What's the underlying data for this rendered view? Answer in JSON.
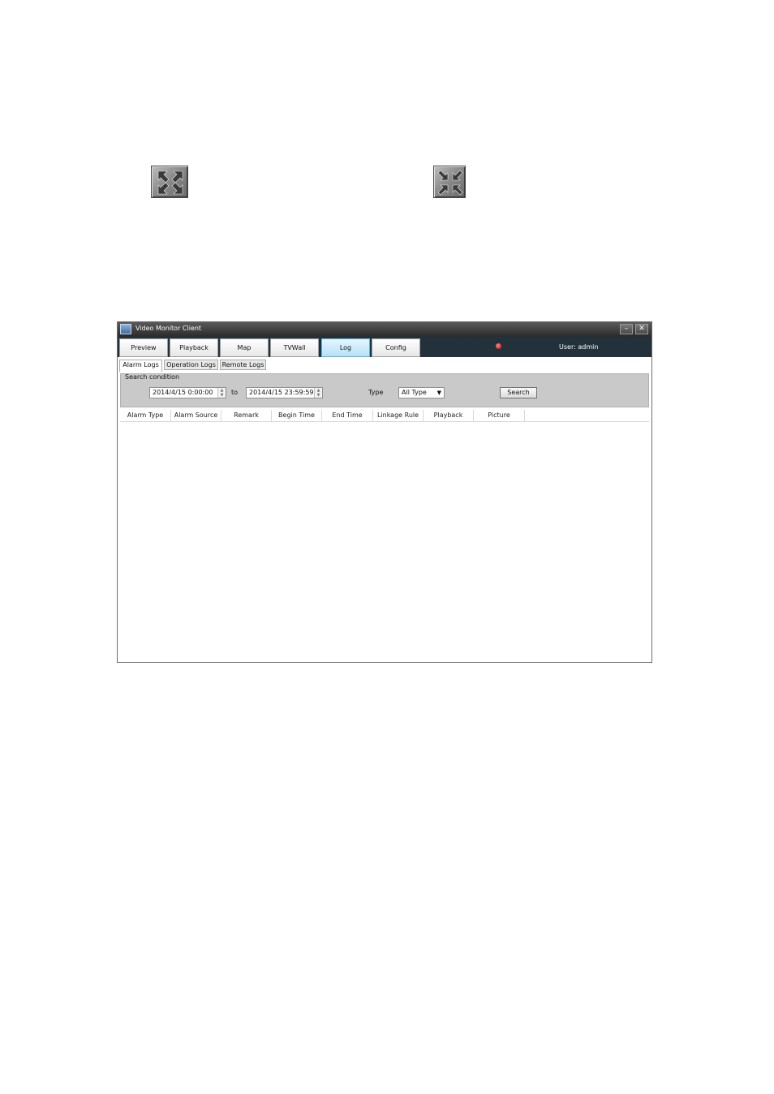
{
  "window": {
    "title": "Video Monitor Client",
    "minimize": "–",
    "close": "✕",
    "menu_tabs": [
      {
        "label": "Preview"
      },
      {
        "label": "Playback"
      },
      {
        "label": "Map"
      },
      {
        "label": "TVWall"
      },
      {
        "label": "Log"
      },
      {
        "label": "Config"
      }
    ],
    "active_tab": "Log",
    "user_label": "User: admin",
    "sub_tabs": [
      "Alarm Logs",
      "Operation Logs",
      "Remote Logs"
    ],
    "active_sub_tab": "Alarm Logs",
    "search": {
      "legend": "Search condition",
      "from_value": "2014/4/15 0:00:00",
      "to_label": "to",
      "to_value": "2014/4/15 23:59:59",
      "type_label": "Type",
      "type_value": "All Type",
      "button": "Search"
    },
    "columns": [
      "Alarm Type",
      "Alarm Source",
      "Remark",
      "Begin Time",
      "End Time",
      "Linkage Rule",
      "Playback",
      "Picture"
    ]
  },
  "icons": {
    "fullscreen": "expand-arrows-icon",
    "exit_fullscreen": "collapse-arrows-icon"
  }
}
